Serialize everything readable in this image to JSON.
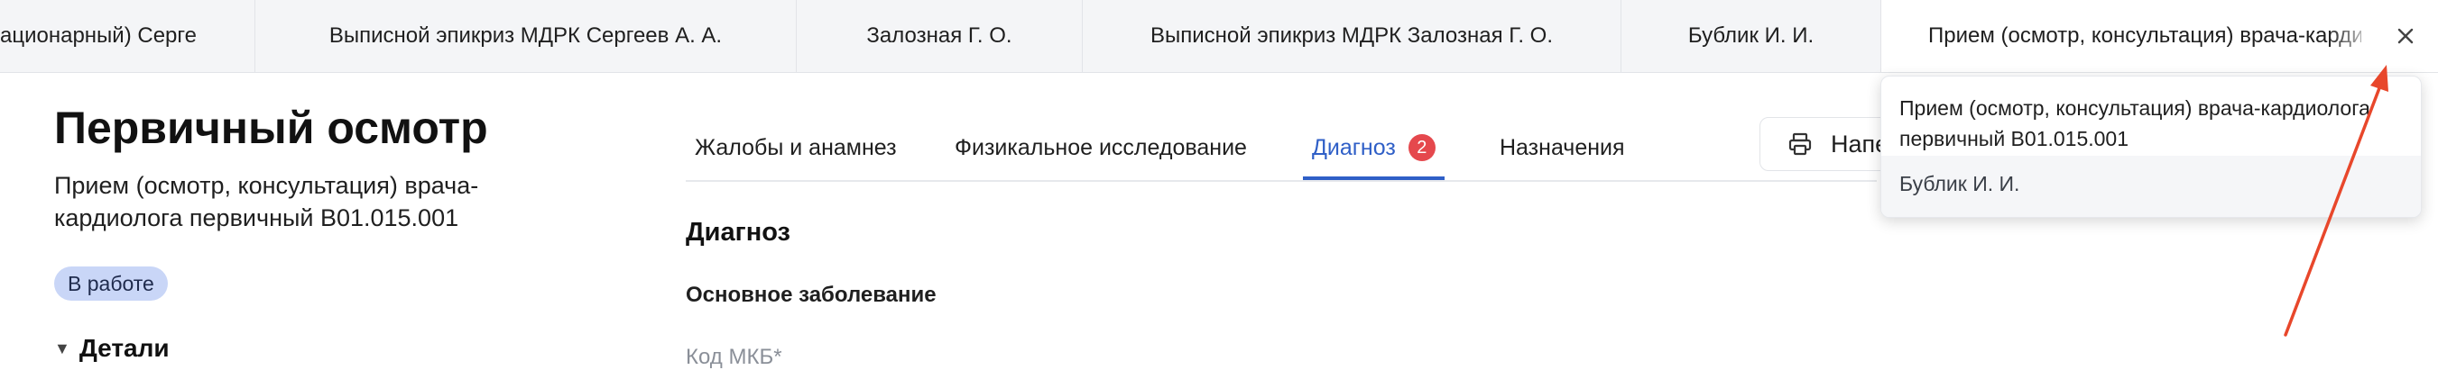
{
  "tabs": [
    {
      "label": "ационарный) Серге"
    },
    {
      "label": "Выписной эпикриз МДРК Сергеев А. А."
    },
    {
      "label": "Залозная Г. О."
    },
    {
      "label": "Выписной эпикриз МДРК Залозная Г. О."
    },
    {
      "label": "Бублик И. И."
    },
    {
      "label": "Прием (осмотр, консультация) врача-кардиолога первичный В01.015.001"
    }
  ],
  "header": {
    "title": "Первичный осмотр",
    "subtitle": "Прием (осмотр, консультация) врача-кардиолога первичный B01.015.001",
    "status": "В работе",
    "details_label": "Детали"
  },
  "section_tabs": [
    {
      "label": "Жалобы и анамнез"
    },
    {
      "label": "Физикальное исследование"
    },
    {
      "label": "Диагноз",
      "badge": "2"
    },
    {
      "label": "Назначения"
    }
  ],
  "print_button": {
    "label": "Напечатать"
  },
  "content": {
    "section_heading": "Диагноз",
    "field_heading": "Основное заболевание",
    "field_label": "Код МКБ*"
  },
  "popover": {
    "title": "Прием (осмотр, консультация) врача-кардиолога первичный B01.015.001",
    "patient": "Бублик И. И."
  },
  "colors": {
    "accent": "#2f5fc7",
    "badge": "#e5484d",
    "status_bg": "#c9d6f7",
    "annotation_arrow": "#e8472b"
  }
}
